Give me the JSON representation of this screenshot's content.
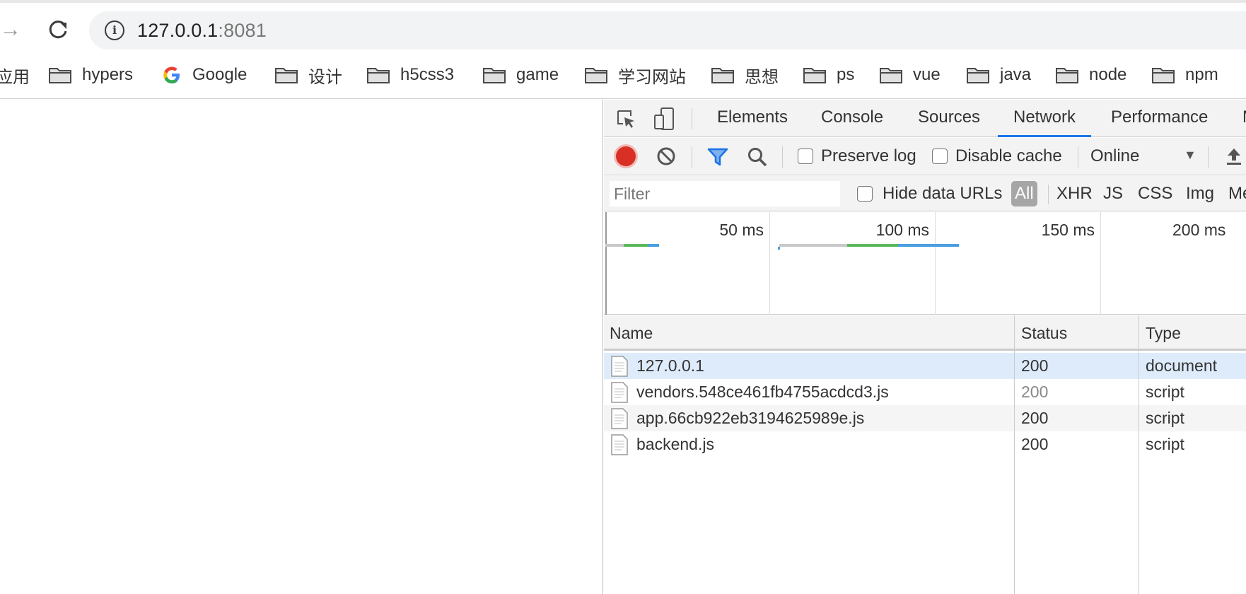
{
  "browser": {
    "url_host": "127.0.0.1",
    "url_port": ":8081"
  },
  "bookmarks": {
    "apps_label": "应用",
    "items": [
      {
        "label": "hypers",
        "icon": "folder-icon"
      },
      {
        "label": "Google",
        "icon": "google-icon"
      },
      {
        "label": "设计",
        "icon": "folder-icon"
      },
      {
        "label": "h5css3",
        "icon": "folder-icon"
      },
      {
        "label": "game",
        "icon": "folder-icon"
      },
      {
        "label": "学习网站",
        "icon": "folder-icon"
      },
      {
        "label": "思想",
        "icon": "folder-icon"
      },
      {
        "label": "ps",
        "icon": "folder-icon"
      },
      {
        "label": "vue",
        "icon": "folder-icon"
      },
      {
        "label": "java",
        "icon": "folder-icon"
      },
      {
        "label": "node",
        "icon": "folder-icon"
      },
      {
        "label": "npm",
        "icon": "folder-icon"
      }
    ]
  },
  "devtools": {
    "tabs": [
      "Elements",
      "Console",
      "Sources",
      "Network",
      "Performance",
      "M"
    ],
    "active_tab": "Network",
    "toolbar": {
      "preserve_log": "Preserve log",
      "disable_cache": "Disable cache",
      "throttling": "Online"
    },
    "filter": {
      "placeholder": "Filter",
      "hide_data_urls": "Hide data URLs",
      "types": [
        "All",
        "XHR",
        "JS",
        "CSS",
        "Img",
        "Me"
      ],
      "active_type": "All"
    },
    "overview": {
      "ticks": [
        "50 ms",
        "100 ms",
        "150 ms",
        "200 ms"
      ]
    },
    "table": {
      "columns": [
        "Name",
        "Status",
        "Type"
      ],
      "rows": [
        {
          "name": "127.0.0.1",
          "status": "200",
          "type": "document",
          "selected": true
        },
        {
          "name": "vendors.548ce461fb4755acdcd3.js",
          "status": "200",
          "type": "script",
          "selected": false,
          "status_muted": true
        },
        {
          "name": "app.66cb922eb3194625989e.js",
          "status": "200",
          "type": "script",
          "selected": false
        },
        {
          "name": "backend.js",
          "status": "200",
          "type": "script",
          "selected": false
        }
      ]
    }
  },
  "colors": {
    "accent": "#1a73e8",
    "record": "#d93025",
    "selected_row": "#deebfb",
    "alt_row": "#f5f5f5",
    "waterfall_waiting": "#c9c9c9",
    "waterfall_ttfb": "#5cb85c",
    "waterfall_download": "#4a9fe0"
  }
}
